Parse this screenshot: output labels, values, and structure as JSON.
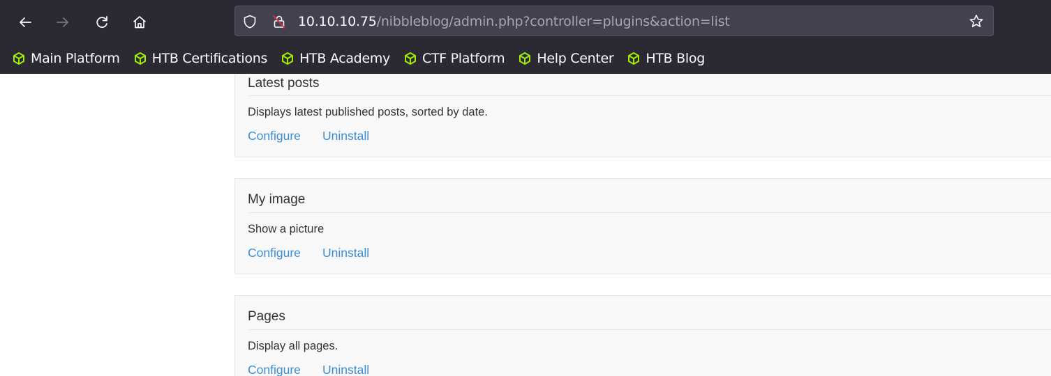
{
  "browser": {
    "url": {
      "host": "10.10.10.75",
      "path": "/nibbleblog/admin.php?controller=plugins&action=list"
    },
    "nav_icons": [
      "back-arrow-icon",
      "forward-arrow-icon",
      "reload-icon",
      "home-icon"
    ],
    "bookmarks": [
      {
        "label": "Main Platform",
        "icon": "htb-cube-icon"
      },
      {
        "label": "HTB Certifications",
        "icon": "htb-cube-icon"
      },
      {
        "label": "HTB Academy",
        "icon": "htb-cube-icon"
      },
      {
        "label": "CTF Platform",
        "icon": "htb-cube-icon"
      },
      {
        "label": "Help Center",
        "icon": "htb-cube-icon"
      },
      {
        "label": "HTB Blog",
        "icon": "htb-cube-icon"
      }
    ],
    "colors": {
      "toolbar_bg": "#2b2a33",
      "urlbar_bg": "#42414d",
      "bookmark_icon": "#9fef00",
      "insecure_lock_strike": "#e22850"
    }
  },
  "plugins": [
    {
      "title": "Latest posts",
      "description": "Displays latest published posts, sorted by date.",
      "configure_label": "Configure",
      "uninstall_label": "Uninstall"
    },
    {
      "title": "My image",
      "description": "Show a picture",
      "configure_label": "Configure",
      "uninstall_label": "Uninstall"
    },
    {
      "title": "Pages",
      "description": "Display all pages.",
      "configure_label": "Configure",
      "uninstall_label": "Uninstall"
    }
  ],
  "page_colors": {
    "link": "#3c8dd4",
    "panel_bg": "#f8f8f8",
    "text": "#333333"
  }
}
